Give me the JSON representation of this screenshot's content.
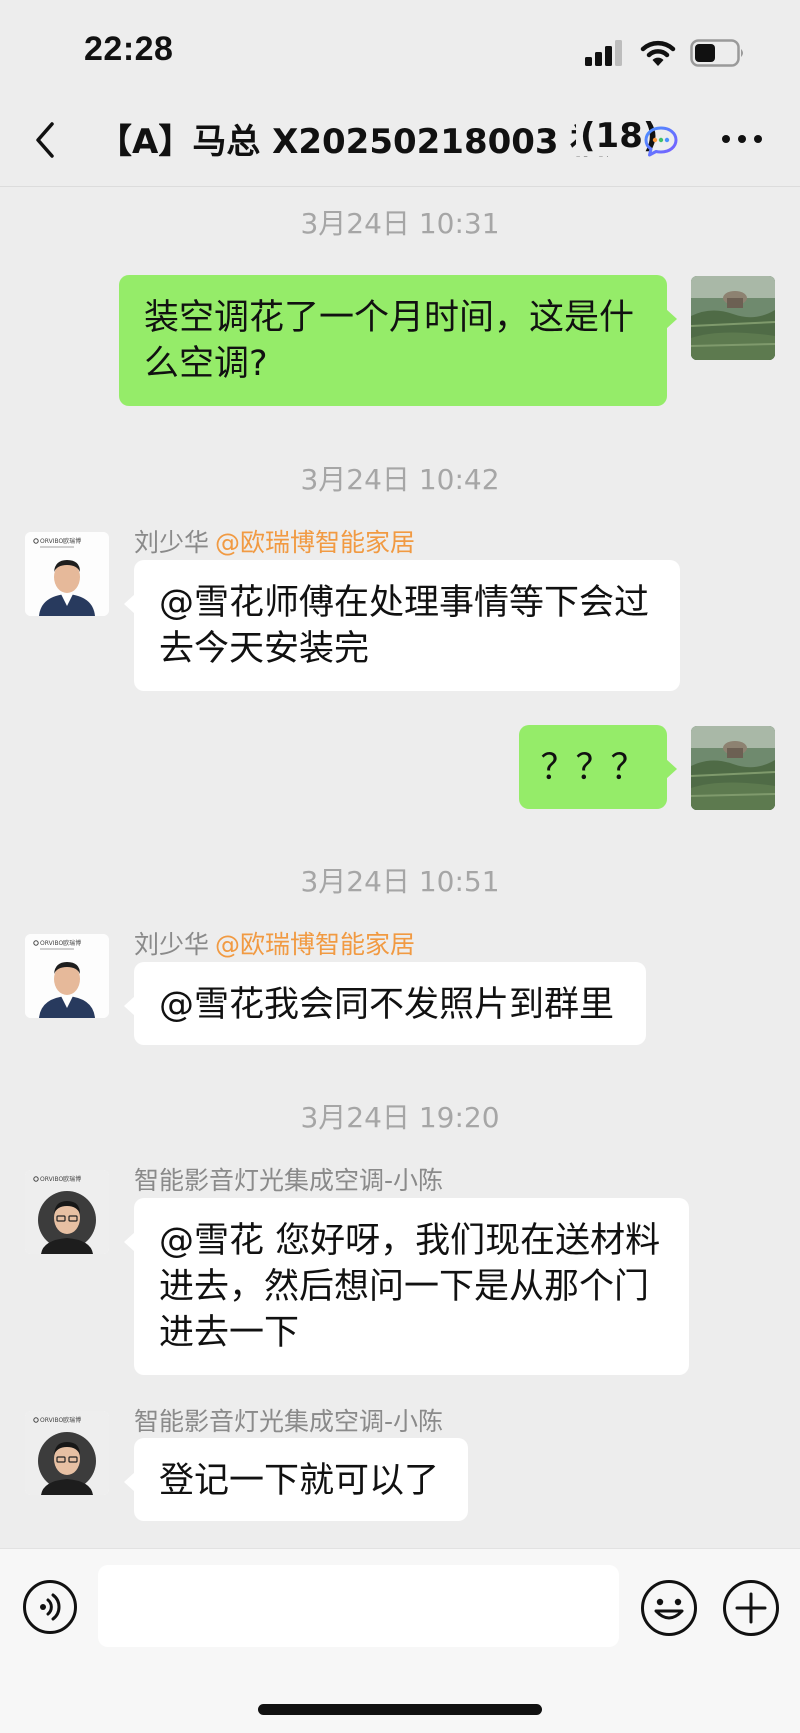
{
  "status_bar": {
    "time": "22:28"
  },
  "header": {
    "title": "【A】马总 X20250218003 福建",
    "member_count": "(18)"
  },
  "messages": [
    {
      "timestamp": "3月24日 10:31"
    },
    {
      "text": "装空调花了一个月时间，这是什么空调?"
    },
    {
      "timestamp": "3月24日 10:42"
    },
    {
      "sender": "刘少华",
      "org": "@欧瑞博智能家居",
      "text": "@雪花师傅在处理事情等下会过去今天安装完"
    },
    {
      "text": "？？？"
    },
    {
      "timestamp": "3月24日 10:51"
    },
    {
      "sender": "刘少华",
      "org": "@欧瑞博智能家居",
      "text": "@雪花我会同不发照片到群里"
    },
    {
      "timestamp": "3月24日 19:20"
    },
    {
      "sender": "智能影音灯光集成空调-小陈",
      "text": "@雪花 您好呀，我们现在送材料进去，然后想问一下是从那个门进去一下"
    },
    {
      "sender": "智能影音灯光集成空调-小陈",
      "text": "登记一下就可以了"
    }
  ],
  "avatar_logo_text": "ORVIBO欧瑞博",
  "input": {
    "value": ""
  },
  "icons": {
    "back": "chevron-left-icon",
    "chatbot": "chat-bubble-icon",
    "more": "more-dots-icon",
    "voice": "voice-icon",
    "emoji": "emoji-icon",
    "plus": "plus-icon"
  },
  "colors": {
    "my_bubble": "#95ec69",
    "other_bubble": "#ffffff",
    "background": "#ededed",
    "org_tag": "#f19a42",
    "timestamp": "#a6a6a6"
  }
}
